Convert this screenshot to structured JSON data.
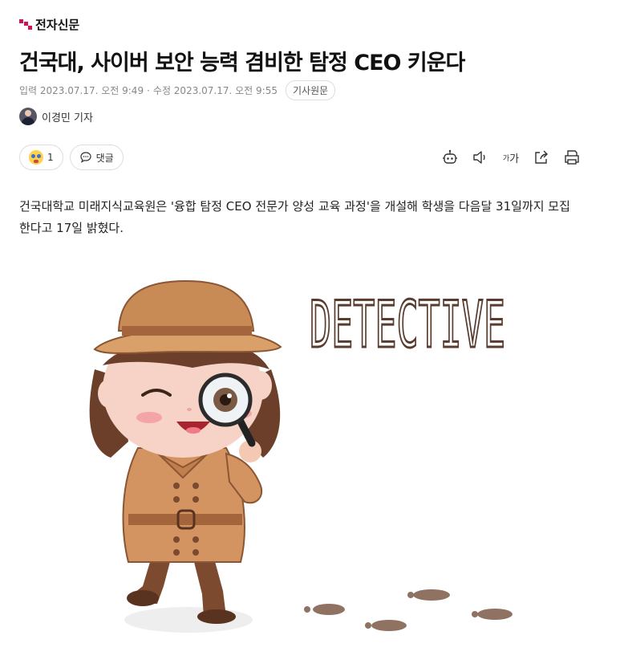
{
  "press": {
    "name": "전자신문"
  },
  "article": {
    "title": "건국대, 사이버 보안 능력 겸비한 탐정 CEO 키운다",
    "published": "입력 2023.07.17. 오전 9:49",
    "separator": "·",
    "modified": "수정 2023.07.17. 오전 9:55",
    "original_button": "기사원문",
    "reporter": "이경민 기자",
    "lead": "건국대학교 미래지식교육원은 '융합 탐정 CEO 전문가 양성 교육 과정'을 개설해 학생을 다음달 31일까지 모집한다고 17일 밝혔다."
  },
  "reactions": {
    "count": "1",
    "comment_label": "댓글"
  },
  "tools": {
    "font_big": "가",
    "font_small": "가"
  },
  "illustration": {
    "caption_text": "DETECTIVE"
  },
  "icons": [
    "press-logo-icon",
    "reaction-emoji-icon",
    "comment-icon",
    "summary-robot-icon",
    "speaker-icon",
    "share-icon",
    "print-icon"
  ],
  "colors": {
    "brand": "#d2115a",
    "coat": "#d39461",
    "hat": "#c98b55"
  }
}
